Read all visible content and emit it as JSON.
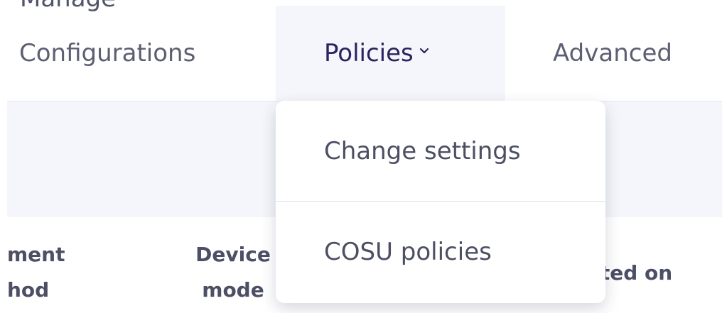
{
  "top_fragment": "Manage",
  "nav": {
    "tabs": [
      {
        "label": "Configurations"
      },
      {
        "label": "Policies",
        "active": true
      },
      {
        "label": "Advanced"
      }
    ]
  },
  "table": {
    "headers": {
      "enrollment_method": "ment\nhod",
      "device_mode": "Device\nmode",
      "created_on": "ated on"
    }
  },
  "policies_menu": {
    "items": [
      {
        "label": "Change settings"
      },
      {
        "label": "COSU policies"
      }
    ]
  },
  "colors": {
    "active_tab_bg": "#f4f6fb",
    "active_tab_text": "#27245f",
    "inactive_tab_text": "#5c5f74",
    "band_bg": "#f4f6fb",
    "menu_divider": "#dde0ea"
  },
  "icons": {
    "policies_dropdown": "chevron-down-icon"
  }
}
